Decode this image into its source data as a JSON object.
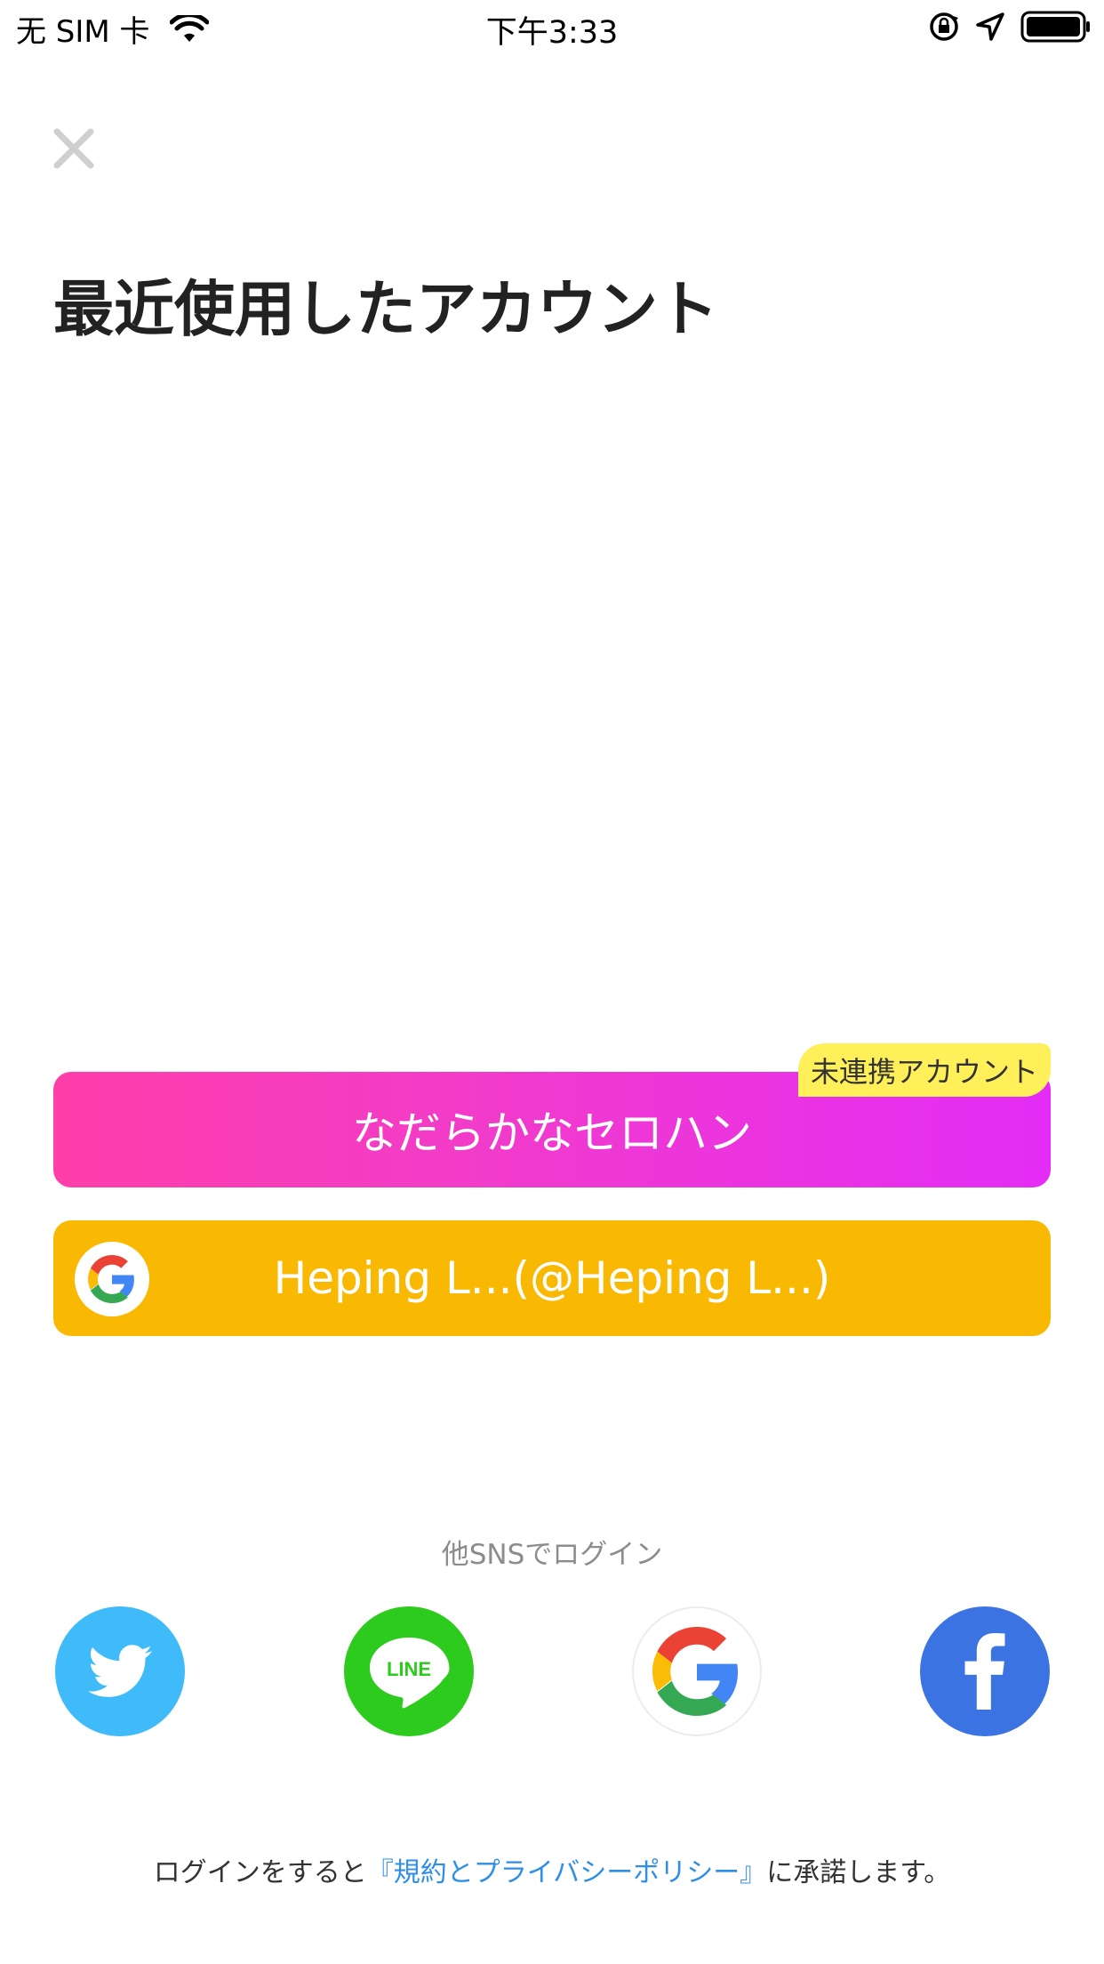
{
  "status_bar": {
    "carrier": "无 SIM 卡",
    "time": "下午3:33"
  },
  "page": {
    "title": "最近使用したアカウント"
  },
  "accounts": [
    {
      "label": "なだらかなセロハン",
      "badge": "未連携アカウント",
      "color": "#f23cc8"
    },
    {
      "label": "Heping L...(@Heping L...)",
      "provider_icon": "google-icon",
      "color": "#f9b902"
    }
  ],
  "other_sns": {
    "label": "他SNSでログイン",
    "items": [
      {
        "name": "twitter",
        "icon": "twitter-icon",
        "color": "#3fbbfa"
      },
      {
        "name": "line",
        "icon": "line-icon",
        "text": "LINE",
        "color": "#2ccb1d"
      },
      {
        "name": "google",
        "icon": "google-icon",
        "color": "#ffffff"
      },
      {
        "name": "facebook",
        "icon": "facebook-icon",
        "color": "#3b73e3"
      }
    ]
  },
  "footer": {
    "before": "ログインをすると",
    "link": "『規約とプライバシーポリシー』",
    "after": "に承諾します。"
  }
}
